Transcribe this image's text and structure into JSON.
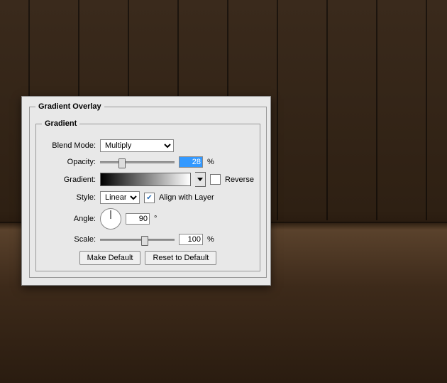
{
  "panel": {
    "title": "Gradient Overlay",
    "group": "Gradient",
    "blend_mode_label": "Blend Mode:",
    "blend_mode_value": "Multiply",
    "opacity_label": "Opacity:",
    "opacity_value": "28",
    "opacity_unit": "%",
    "gradient_label": "Gradient:",
    "reverse_label": "Reverse",
    "reverse_checked": false,
    "style_label": "Style:",
    "style_value": "Linear",
    "align_label": "Align with Layer",
    "align_checked": true,
    "angle_label": "Angle:",
    "angle_value": "90",
    "angle_unit": "°",
    "scale_label": "Scale:",
    "scale_value": "100",
    "scale_unit": "%",
    "make_default": "Make Default",
    "reset_default": "Reset to Default"
  }
}
